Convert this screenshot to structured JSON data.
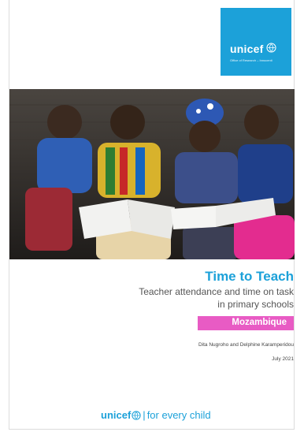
{
  "brand": {
    "logo_text": "unicef",
    "logo_tagline": "Office of Research – Innocenti",
    "color": "#1ca1d9"
  },
  "cover": {
    "title": "Time to Teach",
    "subtitle_line1": "Teacher attendance and time on task",
    "subtitle_line2": "in primary schools",
    "country": "Mozambique",
    "country_color": "#e85bc4",
    "authors": "Dita Nugroho and Delphine Karamperidou",
    "date": "July 2021"
  },
  "footer": {
    "brand": "unicef",
    "separator": "|",
    "slogan": "for every child"
  },
  "photo": {
    "subject": "children-reading-photo"
  }
}
